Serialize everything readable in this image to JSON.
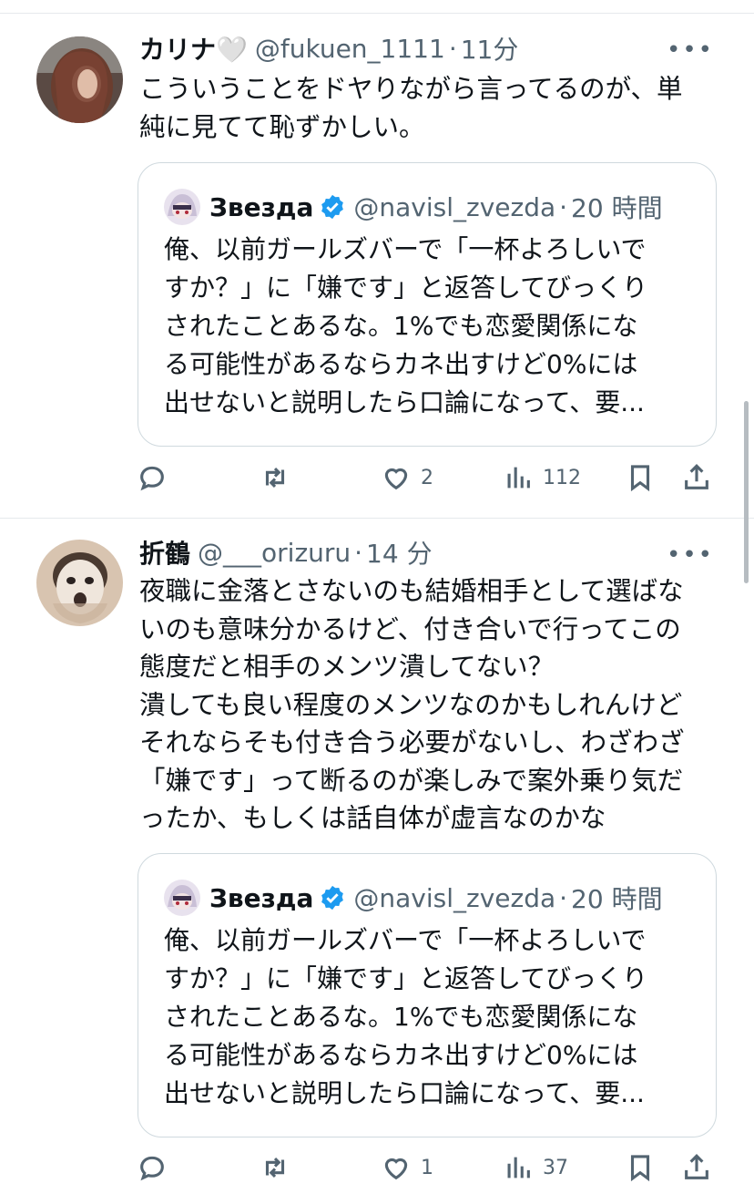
{
  "tweets": [
    {
      "name": "カリナ🤍",
      "handle": "@fukuen_1111",
      "time": "11分",
      "more": "•••",
      "text": "こういうことをドヤりながら言ってるのが、単\n純に見てて恥ずかしい。",
      "quote": {
        "name": "Звезда",
        "handle": "@navisl_zvezda",
        "time": "20 時間",
        "text": "俺、以前ガールズバーで「一杯よろしいで\nすか？」に「嫌です」と返答してびっくり\nされたことあるな。1%でも恋愛関係にな\nる可能性があるならカネ出すけど0%には\n出せないと説明したら口論になって、要..."
      },
      "likes": "2",
      "views": "112"
    },
    {
      "name": "折鶴",
      "handle": "@___orizuru",
      "time": "14 分",
      "more": "•••",
      "text": "夜職に金落とさないのも結婚相手として選ばな\nいのも意味分かるけど、付き合いで行ってこの\n態度だと相手のメンツ潰してない？\n潰しても良い程度のメンツなのかもしれんけど\nそれならそも付き合う必要がないし、わざわざ\n「嫌です」って断るのが楽しみで案外乗り気だ\nったか、もしくは話自体が虚言なのかな",
      "quote": {
        "name": "Звезда",
        "handle": "@navisl_zvezda",
        "time": "20 時間",
        "text": "俺、以前ガールズバーで「一杯よろしいで\nすか？」に「嫌です」と返答してびっくり\nされたことあるな。1%でも恋愛関係にな\nる可能性があるならカネ出すけど0%には\n出せないと説明したら口論になって、要..."
      },
      "likes": "1",
      "views": "37"
    }
  ],
  "colors": {
    "text": "#0f1419",
    "secondary": "#536471",
    "border": "#cfd9de",
    "verified": "#1d9bf0"
  },
  "icons": [
    "reply-icon",
    "retweet-icon",
    "like-icon",
    "views-icon",
    "bookmark-icon",
    "share-icon",
    "verified-badge-icon",
    "more-icon"
  ]
}
